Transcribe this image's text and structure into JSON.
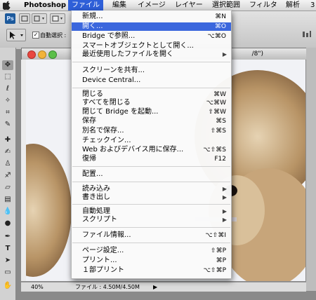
{
  "menubar": {
    "app": "Photoshop",
    "items": [
      "ファイル",
      "編集",
      "イメージ",
      "レイヤー",
      "選択範囲",
      "フィルタ",
      "解析",
      "3"
    ]
  },
  "options": {
    "auto_select_label": "自動選択 :",
    "ps_logo": "Ps"
  },
  "document": {
    "title_fragment": "/8\")",
    "zoom": "40%",
    "file_info": "ファイル : 4.50M/4.50M"
  },
  "file_menu": {
    "new": {
      "label": "新規...",
      "shortcut": "⌘N"
    },
    "open": {
      "label": "開く...",
      "shortcut": "⌘O"
    },
    "bridge_browse": {
      "label": "Bridge で参照...",
      "shortcut": "⌥⌘O"
    },
    "open_smart_object": {
      "label": "スマートオブジェクトとして開く..."
    },
    "open_recent": {
      "label": "最近使用したファイルを開く"
    },
    "share_screen": {
      "label": "スクリーンを共有..."
    },
    "device_central": {
      "label": "Device Central..."
    },
    "close": {
      "label": "閉じる",
      "shortcut": "⌘W"
    },
    "close_all": {
      "label": "すべてを閉じる",
      "shortcut": "⌥⌘W"
    },
    "close_go_bridge": {
      "label": "閉じて Bridge を起動...",
      "shortcut": "⇧⌘W"
    },
    "save": {
      "label": "保存",
      "shortcut": "⌘S"
    },
    "save_as": {
      "label": "別名で保存...",
      "shortcut": "⇧⌘S"
    },
    "check_in": {
      "label": "チェックイン..."
    },
    "save_for_web": {
      "label": "Web およびデバイス用に保存...",
      "shortcut": "⌥⇧⌘S"
    },
    "revert": {
      "label": "復帰",
      "shortcut": "F12"
    },
    "place": {
      "label": "配置..."
    },
    "import": {
      "label": "読み込み"
    },
    "export": {
      "label": "書き出し"
    },
    "automate": {
      "label": "自動処理"
    },
    "scripts": {
      "label": "スクリプト"
    },
    "file_info": {
      "label": "ファイル情報...",
      "shortcut": "⌥⇧⌘I"
    },
    "page_setup": {
      "label": "ページ設定...",
      "shortcut": "⇧⌘P"
    },
    "print": {
      "label": "プリント...",
      "shortcut": "⌘P"
    },
    "print_one": {
      "label": "１部プリント",
      "shortcut": "⌥⇧⌘P"
    }
  },
  "colors": {
    "highlight": "#3b67dd",
    "menubar_active": "#2f60d9"
  }
}
